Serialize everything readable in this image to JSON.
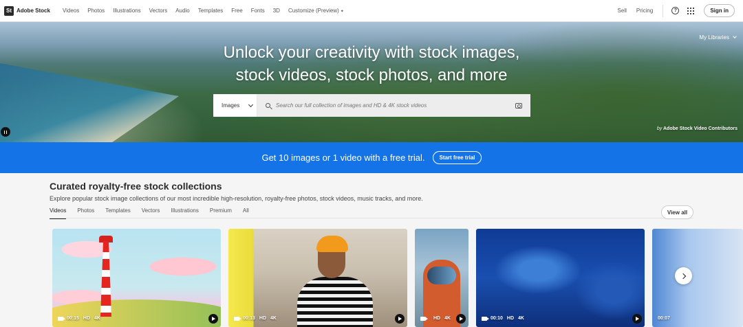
{
  "brand": {
    "logo_mark": "St",
    "name": "Adobe Stock"
  },
  "nav": {
    "items": [
      {
        "label": "Videos"
      },
      {
        "label": "Photos"
      },
      {
        "label": "Illustrations"
      },
      {
        "label": "Vectors"
      },
      {
        "label": "Audio"
      },
      {
        "label": "Templates"
      },
      {
        "label": "Free"
      },
      {
        "label": "Fonts"
      },
      {
        "label": "3D"
      },
      {
        "label": "Customize (Preview)"
      }
    ],
    "sell": "Sell",
    "pricing": "Pricing",
    "help_icon": "help-icon",
    "apps_icon": "apps-grid-icon",
    "sign_in": "Sign in"
  },
  "hero": {
    "title_line1": "Unlock your creativity with stock images,",
    "title_line2": "stock videos, stock photos, and more",
    "my_libraries": "My Libraries",
    "credit_by": "by",
    "credit_name": "Adobe Stock Video Contributors",
    "search": {
      "type_selected": "Images",
      "placeholder": "Search our full collection of images and HD & 4K stock videos"
    }
  },
  "trial": {
    "text": "Get 10 images or 1 video with a free trial.",
    "button": "Start free trial",
    "color": "#1473e6"
  },
  "curated": {
    "title": "Curated royalty-free stock collections",
    "description": "Explore popular stock image collections of our most incredible high-resolution, royalty-free photos, stock videos, music tracks, and more.",
    "tabs": [
      {
        "label": "Videos",
        "active": true
      },
      {
        "label": "Photos"
      },
      {
        "label": "Templates"
      },
      {
        "label": "Vectors"
      },
      {
        "label": "Illustrations"
      },
      {
        "label": "Premium"
      },
      {
        "label": "All"
      }
    ],
    "view_all": "View all",
    "cards": [
      {
        "duration": "00:15",
        "quality": "HD",
        "resolution": "4K"
      },
      {
        "duration": "00:13",
        "quality": "HD",
        "resolution": "4K"
      },
      {
        "duration": "",
        "quality": "HD",
        "resolution": "4K"
      },
      {
        "duration": "00:10",
        "quality": "HD",
        "resolution": "4K"
      },
      {
        "duration": "00:07",
        "quality": "",
        "resolution": ""
      }
    ]
  }
}
